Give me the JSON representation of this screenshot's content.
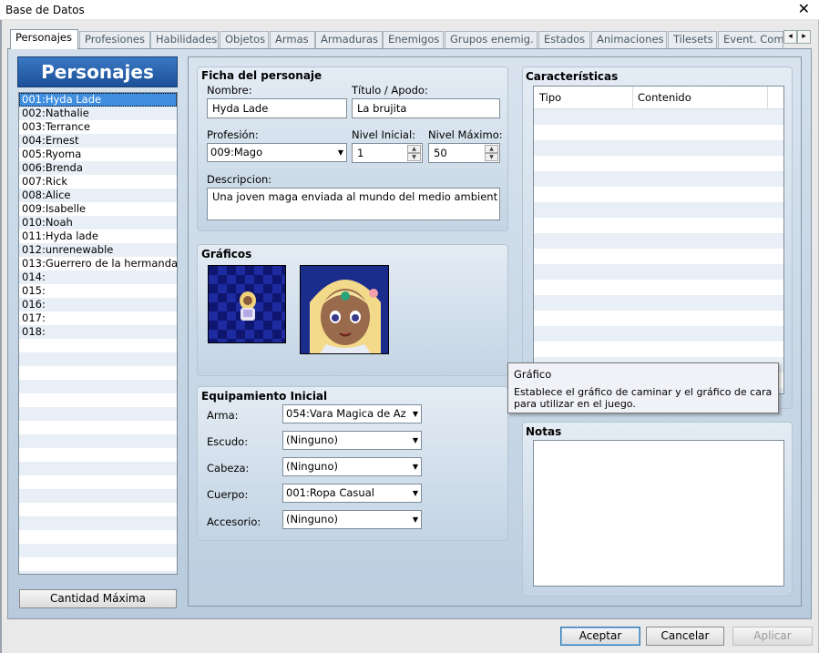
{
  "window": {
    "title": "Base de Datos",
    "close": "✕"
  },
  "tabs": [
    "Personajes",
    "Profesiones",
    "Habilidades",
    "Objetos",
    "Armas",
    "Armaduras",
    "Enemigos",
    "Grupos enemig.",
    "Estados",
    "Animaciones",
    "Tilesets",
    "Event. Com"
  ],
  "tab_nav": {
    "left": "◂",
    "right": "▸"
  },
  "sidebar": {
    "header": "Personajes",
    "items": [
      "001:Hyda Lade",
      "002:Nathalie",
      "003:Terrance",
      "004:Ernest",
      "005:Ryoma",
      "006:Brenda",
      "007:Rick",
      "008:Alice",
      "009:Isabelle",
      "010:Noah",
      "011:Hyda lade",
      "012:unrenewable",
      "013:Guerrero de la hermanda",
      "014:",
      "015:",
      "016:",
      "017:",
      "018:"
    ],
    "max_button": "Cantidad Máxima"
  },
  "ficha": {
    "title": "Ficha del personaje",
    "nombre_label": "Nombre:",
    "nombre_value": "Hyda Lade",
    "titulo_label": "Título / Apodo:",
    "titulo_value": "La brujita",
    "profesion_label": "Profesión:",
    "profesion_value": "009:Mago",
    "nivel_ini_label": "Nivel Inicial:",
    "nivel_ini_value": "1",
    "nivel_max_label": "Nivel Máximo:",
    "nivel_max_value": "50",
    "descripcion_label": "Descripcion:",
    "descripcion_value": "Una joven maga enviada al mundo del medio ambient"
  },
  "graficos": {
    "title": "Gráficos"
  },
  "equipamiento": {
    "title": "Equipamiento Inicial",
    "slots": [
      {
        "label": "Arma:",
        "value": "054:Vara Magica de Az"
      },
      {
        "label": "Escudo:",
        "value": "(Ninguno)"
      },
      {
        "label": "Cabeza:",
        "value": "(Ninguno)"
      },
      {
        "label": "Cuerpo:",
        "value": "001:Ropa Casual"
      },
      {
        "label": "Accesorio:",
        "value": "(Ninguno)"
      }
    ]
  },
  "caracteristicas": {
    "title": "Características",
    "col_tipo": "Tipo",
    "col_contenido": "Contenido"
  },
  "notas": {
    "title": "Notas"
  },
  "tooltip": {
    "title": "Gráfico",
    "body": "Establece el gráfico de caminar y el gráfico de cara para utilizar en el juego."
  },
  "footer": {
    "ok": "Aceptar",
    "cancel": "Cancelar",
    "apply": "Aplicar"
  },
  "colors": {
    "accent": "#1b4f98",
    "selection": "#3f8ee0",
    "panel": "#c3d4e4"
  }
}
